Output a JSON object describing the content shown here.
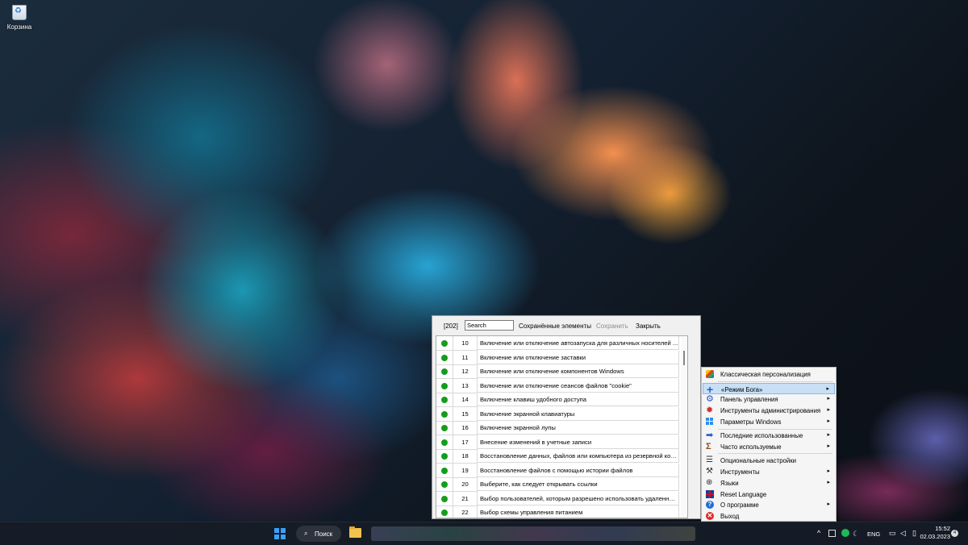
{
  "desktop": {
    "recycle_bin_label": "Корзина"
  },
  "listwin": {
    "count": "[202]",
    "search_value": "Search",
    "saved_items_label": "Сохранённые элементы",
    "save_label": "Сохранить",
    "close_label": "Закрыть",
    "rows": [
      {
        "num": "10",
        "text": "Включение или отключение автозапуска для различных носителей ..."
      },
      {
        "num": "11",
        "text": "Включение или отключение заставки"
      },
      {
        "num": "12",
        "text": "Включение или отключение компонентов Windows"
      },
      {
        "num": "13",
        "text": "Включение или отключение сеансов файлов \"cookie\""
      },
      {
        "num": "14",
        "text": "Включение клавиш удобного доступа"
      },
      {
        "num": "15",
        "text": "Включение экранной клавиатуры"
      },
      {
        "num": "16",
        "text": "Включение экранной лупы"
      },
      {
        "num": "17",
        "text": "Внесение изменений в учетные записи"
      },
      {
        "num": "18",
        "text": "Восстановление данных, файлов или компьютера из резервной коп..."
      },
      {
        "num": "19",
        "text": "Восстановление файлов с помощью истории файлов"
      },
      {
        "num": "20",
        "text": "Выберите, как следует открывать ссылки"
      },
      {
        "num": "21",
        "text": "Выбор пользователей, которым разрешено использовать удаленны..."
      },
      {
        "num": "22",
        "text": "Выбор схемы управления питанием"
      }
    ],
    "status_color": "#159c1d"
  },
  "menu": {
    "items": [
      {
        "label": "Классическая персонализация",
        "icon": "classic-personalization-icon",
        "submenu": false
      },
      {
        "label": "«Режим Бога»",
        "icon": "plus-icon",
        "submenu": true,
        "highlighted": true
      },
      {
        "label": "Панель управления",
        "icon": "control-panel-gear-icon",
        "submenu": true
      },
      {
        "label": "Инструменты администрирования",
        "icon": "admin-tools-gear-icon",
        "submenu": true
      },
      {
        "label": "Параметры Windows",
        "icon": "windows-logo-icon",
        "submenu": true
      },
      {
        "label": "Последние использованные",
        "icon": "arrow-right-icon",
        "submenu": true
      },
      {
        "label": "Часто используемые",
        "icon": "sigma-icon",
        "submenu": true
      },
      {
        "label": "Опциональные настройки",
        "icon": "sliders-icon",
        "submenu": false
      },
      {
        "label": "Инструменты",
        "icon": "tools-icon",
        "submenu": true
      },
      {
        "label": "Языки",
        "icon": "globe-icon",
        "submenu": true
      },
      {
        "label": "Reset Language",
        "icon": "uk-flag-icon",
        "submenu": false
      },
      {
        "label": "О программе",
        "icon": "help-icon",
        "submenu": true
      },
      {
        "label": "Выход",
        "icon": "exit-icon",
        "submenu": false
      }
    ],
    "highlight_color": "#c8dff5"
  },
  "taskbar": {
    "search_label": "Поиск",
    "language": "ENG",
    "time": "15:52",
    "date": "02.03.2023",
    "notification_count": "4"
  }
}
